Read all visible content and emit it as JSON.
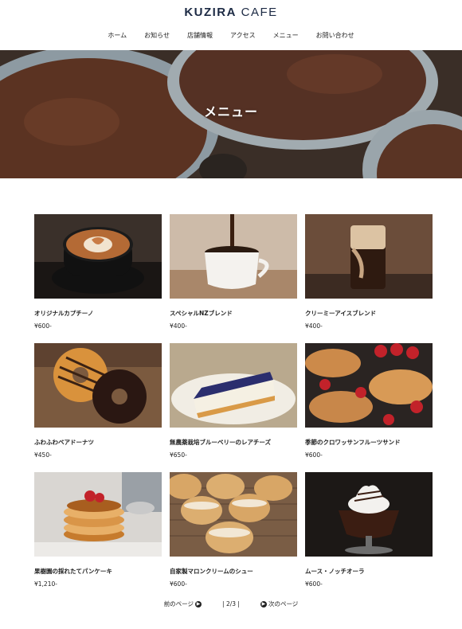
{
  "header": {
    "logo_bold": "KUZIRA",
    "logo_light": "CAFE",
    "nav": [
      "ホーム",
      "お知らせ",
      "店舗情報",
      "アクセス",
      "メニュー",
      "お問い合わせ"
    ]
  },
  "hero": {
    "title": "メニュー"
  },
  "menu": [
    {
      "name": "オリジナルカプチーノ",
      "price": "¥600-"
    },
    {
      "name": "スペシャルNZブレンド",
      "price": "¥400-"
    },
    {
      "name": "クリーミーアイスブレンド",
      "price": "¥400-"
    },
    {
      "name": "ふわふわベアドーナツ",
      "price": "¥450-"
    },
    {
      "name": "無農薬栽培ブルーベリーのレアチーズ",
      "price": "¥650-"
    },
    {
      "name": "季節のクロワッサンフルーツサンド",
      "price": "¥600-"
    },
    {
      "name": "果樹園の採れたてパンケーキ",
      "price": "¥1,210-"
    },
    {
      "name": "自家製マロンクリームのシュー",
      "price": "¥600-"
    },
    {
      "name": "ムース・ノッチオーラ",
      "price": "¥600-"
    }
  ],
  "pager": {
    "prev": "前のページ",
    "count": "| 2/3 |",
    "next": "次のページ"
  },
  "colors": {
    "logo": "#1c2a44",
    "text": "#222222"
  }
}
